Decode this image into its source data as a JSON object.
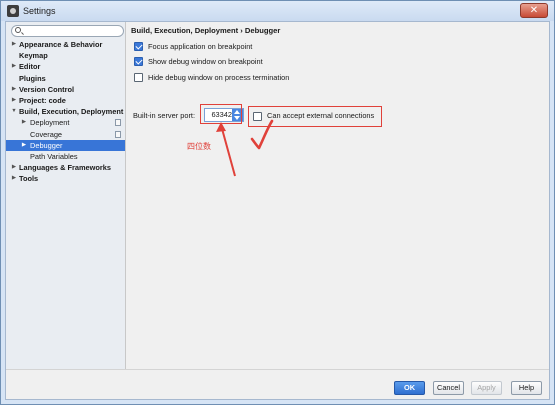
{
  "window": {
    "title": "Settings",
    "close_label": "✕"
  },
  "search": {
    "placeholder": ""
  },
  "sidebar": {
    "items": [
      {
        "label": "Appearance & Behavior",
        "arrow": "▶"
      },
      {
        "label": "Keymap",
        "arrow": ""
      },
      {
        "label": "Editor",
        "arrow": "▶"
      },
      {
        "label": "Plugins",
        "arrow": ""
      },
      {
        "label": "Version Control",
        "arrow": "▶"
      },
      {
        "label": "Project: code",
        "arrow": "▶"
      },
      {
        "label": "Build, Execution, Deployment",
        "arrow": "▼"
      },
      {
        "label": "Deployment",
        "arrow": "▶"
      },
      {
        "label": "Coverage",
        "arrow": ""
      },
      {
        "label": "Debugger",
        "arrow": "▶"
      },
      {
        "label": "Path Variables",
        "arrow": ""
      },
      {
        "label": "Languages & Frameworks",
        "arrow": "▶"
      },
      {
        "label": "Tools",
        "arrow": "▶"
      }
    ]
  },
  "content": {
    "breadcrumb": "Build, Execution, Deployment › Debugger",
    "options": [
      {
        "label": "Focus application on breakpoint",
        "checked": true
      },
      {
        "label": "Show debug window on breakpoint",
        "checked": true
      },
      {
        "label": "Hide debug window on process termination",
        "checked": false
      }
    ],
    "port": {
      "label": "Built-in server port:",
      "value": "63342"
    },
    "external": {
      "label": "Can accept external connections",
      "checked": false
    },
    "annotation": "四位数"
  },
  "footer": {
    "ok_label": "OK",
    "cancel_label": "Cancel",
    "apply_label": "Apply",
    "help_label": "Help"
  },
  "colors": {
    "accent": "#3875d7",
    "annotation": "#e0413a"
  }
}
